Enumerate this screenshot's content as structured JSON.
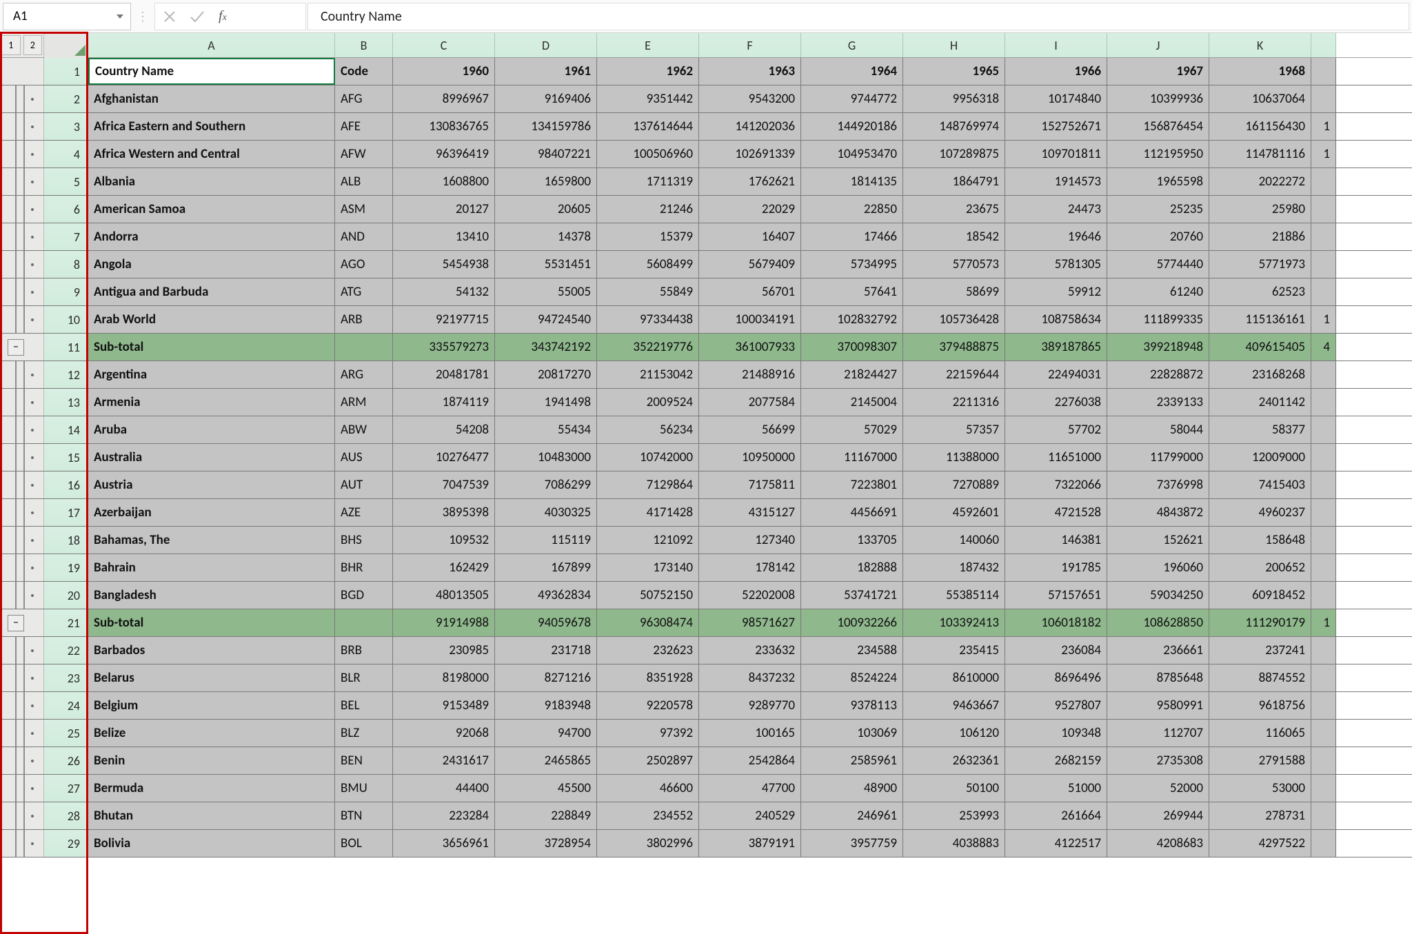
{
  "name_box": "A1",
  "formula_content": "Country Name",
  "outline_levels": [
    "1",
    "2"
  ],
  "columns": [
    "A",
    "B",
    "C",
    "D",
    "E",
    "F",
    "G",
    "H",
    "I",
    "J",
    "K"
  ],
  "header": {
    "name": "Country Name",
    "code": "Code",
    "years": [
      "1960",
      "1961",
      "1962",
      "1963",
      "1964",
      "1965",
      "1966",
      "1967",
      "1968"
    ]
  },
  "rows": [
    {
      "n": 2,
      "type": "data",
      "name": "Afghanistan",
      "code": "AFG",
      "vals": [
        "8996967",
        "9169406",
        "9351442",
        "9543200",
        "9744772",
        "9956318",
        "10174840",
        "10399936",
        "10637064"
      ]
    },
    {
      "n": 3,
      "type": "data",
      "name": "Africa Eastern and Southern",
      "code": "AFE",
      "vals": [
        "130836765",
        "134159786",
        "137614644",
        "141202036",
        "144920186",
        "148769974",
        "152752671",
        "156876454",
        "161156430"
      ],
      "overflow": "1"
    },
    {
      "n": 4,
      "type": "data",
      "name": "Africa Western and Central",
      "code": "AFW",
      "vals": [
        "96396419",
        "98407221",
        "100506960",
        "102691339",
        "104953470",
        "107289875",
        "109701811",
        "112195950",
        "114781116"
      ],
      "overflow": "1"
    },
    {
      "n": 5,
      "type": "data",
      "name": "Albania",
      "code": "ALB",
      "vals": [
        "1608800",
        "1659800",
        "1711319",
        "1762621",
        "1814135",
        "1864791",
        "1914573",
        "1965598",
        "2022272"
      ]
    },
    {
      "n": 6,
      "type": "data",
      "name": "American Samoa",
      "code": "ASM",
      "vals": [
        "20127",
        "20605",
        "21246",
        "22029",
        "22850",
        "23675",
        "24473",
        "25235",
        "25980"
      ]
    },
    {
      "n": 7,
      "type": "data",
      "name": "Andorra",
      "code": "AND",
      "vals": [
        "13410",
        "14378",
        "15379",
        "16407",
        "17466",
        "18542",
        "19646",
        "20760",
        "21886"
      ]
    },
    {
      "n": 8,
      "type": "data",
      "name": "Angola",
      "code": "AGO",
      "vals": [
        "5454938",
        "5531451",
        "5608499",
        "5679409",
        "5734995",
        "5770573",
        "5781305",
        "5774440",
        "5771973"
      ]
    },
    {
      "n": 9,
      "type": "data",
      "name": "Antigua and Barbuda",
      "code": "ATG",
      "vals": [
        "54132",
        "55005",
        "55849",
        "56701",
        "57641",
        "58699",
        "59912",
        "61240",
        "62523"
      ]
    },
    {
      "n": 10,
      "type": "data",
      "name": "Arab World",
      "code": "ARB",
      "vals": [
        "92197715",
        "94724540",
        "97334438",
        "100034191",
        "102832792",
        "105736428",
        "108758634",
        "111899335",
        "115136161"
      ],
      "overflow": "1"
    },
    {
      "n": 11,
      "type": "subtotal",
      "name": "Sub-total",
      "code": "",
      "vals": [
        "335579273",
        "343742192",
        "352219776",
        "361007933",
        "370098307",
        "379488875",
        "389187865",
        "399218948",
        "409615405"
      ],
      "overflow": "4"
    },
    {
      "n": 12,
      "type": "data",
      "name": "Argentina",
      "code": "ARG",
      "vals": [
        "20481781",
        "20817270",
        "21153042",
        "21488916",
        "21824427",
        "22159644",
        "22494031",
        "22828872",
        "23168268"
      ]
    },
    {
      "n": 13,
      "type": "data",
      "name": "Armenia",
      "code": "ARM",
      "vals": [
        "1874119",
        "1941498",
        "2009524",
        "2077584",
        "2145004",
        "2211316",
        "2276038",
        "2339133",
        "2401142"
      ]
    },
    {
      "n": 14,
      "type": "data",
      "name": "Aruba",
      "code": "ABW",
      "vals": [
        "54208",
        "55434",
        "56234",
        "56699",
        "57029",
        "57357",
        "57702",
        "58044",
        "58377"
      ]
    },
    {
      "n": 15,
      "type": "data",
      "name": "Australia",
      "code": "AUS",
      "vals": [
        "10276477",
        "10483000",
        "10742000",
        "10950000",
        "11167000",
        "11388000",
        "11651000",
        "11799000",
        "12009000"
      ]
    },
    {
      "n": 16,
      "type": "data",
      "name": "Austria",
      "code": "AUT",
      "vals": [
        "7047539",
        "7086299",
        "7129864",
        "7175811",
        "7223801",
        "7270889",
        "7322066",
        "7376998",
        "7415403"
      ]
    },
    {
      "n": 17,
      "type": "data",
      "name": "Azerbaijan",
      "code": "AZE",
      "vals": [
        "3895398",
        "4030325",
        "4171428",
        "4315127",
        "4456691",
        "4592601",
        "4721528",
        "4843872",
        "4960237"
      ]
    },
    {
      "n": 18,
      "type": "data",
      "name": "Bahamas, The",
      "code": "BHS",
      "vals": [
        "109532",
        "115119",
        "121092",
        "127340",
        "133705",
        "140060",
        "146381",
        "152621",
        "158648"
      ]
    },
    {
      "n": 19,
      "type": "data",
      "name": "Bahrain",
      "code": "BHR",
      "vals": [
        "162429",
        "167899",
        "173140",
        "178142",
        "182888",
        "187432",
        "191785",
        "196060",
        "200652"
      ]
    },
    {
      "n": 20,
      "type": "data",
      "name": "Bangladesh",
      "code": "BGD",
      "vals": [
        "48013505",
        "49362834",
        "50752150",
        "52202008",
        "53741721",
        "55385114",
        "57157651",
        "59034250",
        "60918452"
      ]
    },
    {
      "n": 21,
      "type": "subtotal",
      "name": "Sub-total",
      "code": "",
      "vals": [
        "91914988",
        "94059678",
        "96308474",
        "98571627",
        "100932266",
        "103392413",
        "106018182",
        "108628850",
        "111290179"
      ],
      "overflow": "1"
    },
    {
      "n": 22,
      "type": "data",
      "name": "Barbados",
      "code": "BRB",
      "vals": [
        "230985",
        "231718",
        "232623",
        "233632",
        "234588",
        "235415",
        "236084",
        "236661",
        "237241"
      ]
    },
    {
      "n": 23,
      "type": "data",
      "name": "Belarus",
      "code": "BLR",
      "vals": [
        "8198000",
        "8271216",
        "8351928",
        "8437232",
        "8524224",
        "8610000",
        "8696496",
        "8785648",
        "8874552"
      ]
    },
    {
      "n": 24,
      "type": "data",
      "name": "Belgium",
      "code": "BEL",
      "vals": [
        "9153489",
        "9183948",
        "9220578",
        "9289770",
        "9378113",
        "9463667",
        "9527807",
        "9580991",
        "9618756"
      ]
    },
    {
      "n": 25,
      "type": "data",
      "name": "Belize",
      "code": "BLZ",
      "vals": [
        "92068",
        "94700",
        "97392",
        "100165",
        "103069",
        "106120",
        "109348",
        "112707",
        "116065"
      ]
    },
    {
      "n": 26,
      "type": "data",
      "name": "Benin",
      "code": "BEN",
      "vals": [
        "2431617",
        "2465865",
        "2502897",
        "2542864",
        "2585961",
        "2632361",
        "2682159",
        "2735308",
        "2791588"
      ]
    },
    {
      "n": 27,
      "type": "data",
      "name": "Bermuda",
      "code": "BMU",
      "vals": [
        "44400",
        "45500",
        "46600",
        "47700",
        "48900",
        "50100",
        "51000",
        "52000",
        "53000"
      ]
    },
    {
      "n": 28,
      "type": "data",
      "name": "Bhutan",
      "code": "BTN",
      "vals": [
        "223284",
        "228849",
        "234552",
        "240529",
        "246961",
        "253993",
        "261664",
        "269944",
        "278731"
      ]
    },
    {
      "n": 29,
      "type": "data",
      "name": "Bolivia",
      "code": "BOL",
      "vals": [
        "3656961",
        "3728954",
        "3802996",
        "3879191",
        "3957759",
        "4038883",
        "4122517",
        "4208683",
        "4297522"
      ]
    }
  ]
}
